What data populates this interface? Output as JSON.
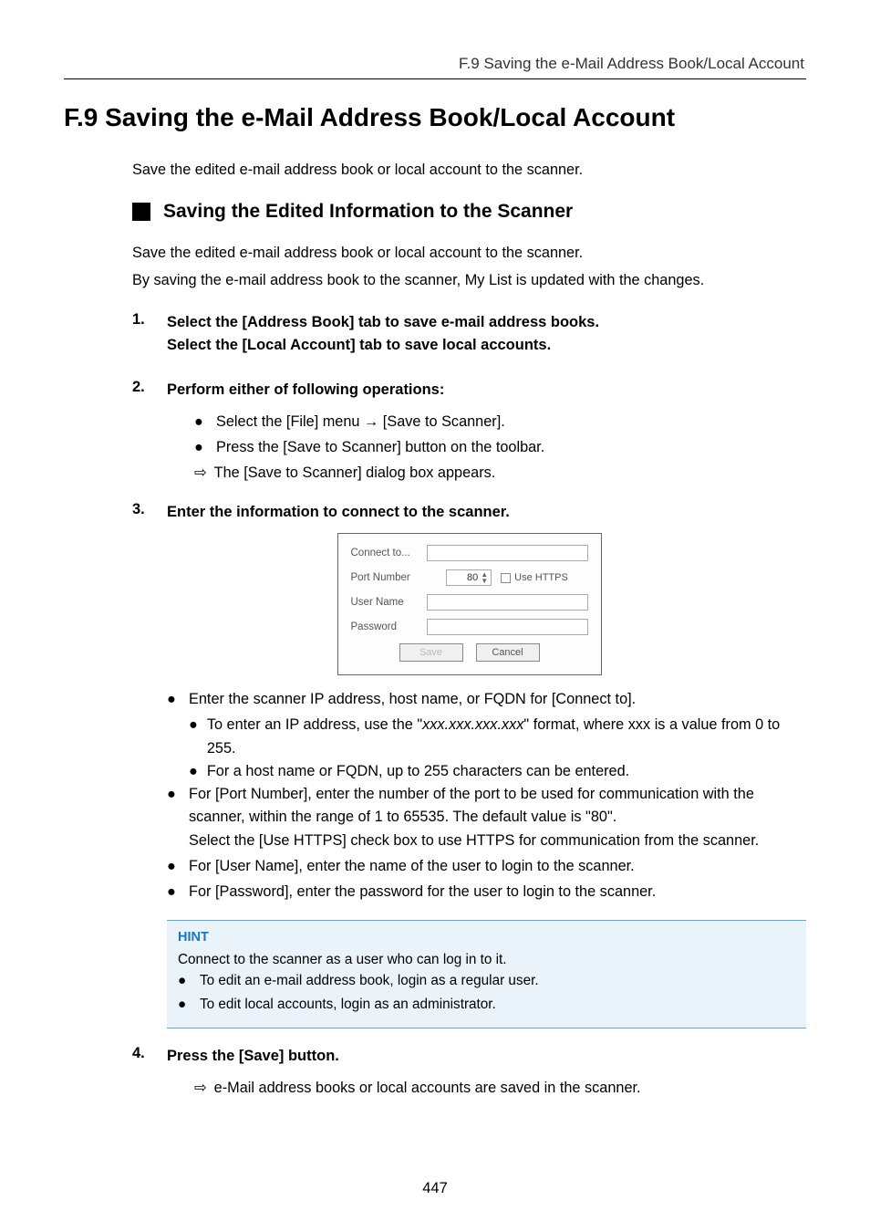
{
  "header": {
    "running": "F.9 Saving the e-Mail Address Book/Local Account"
  },
  "title": "F.9  Saving the e-Mail Address Book/Local Account",
  "intro": "Save the edited e-mail address book or local account to the scanner.",
  "subsection": {
    "title": "Saving the Edited Information to the Scanner",
    "para1": "Save the edited e-mail address book or local account to the scanner.",
    "para2": "By saving the e-mail address book to the scanner, My List is updated with the changes."
  },
  "steps": {
    "s1": {
      "num": "1.",
      "line1": "Select the [Address Book] tab to save e-mail address books.",
      "line2": "Select the [Local Account] tab to save local accounts."
    },
    "s2": {
      "num": "2.",
      "title": "Perform either of following operations:",
      "b1a": "Select the [File] menu ",
      "b1b": " [Save to Scanner].",
      "b2": "Press the [Save to Scanner] button on the toolbar.",
      "r1": "The [Save to Scanner] dialog box appears."
    },
    "s3": {
      "num": "3.",
      "title": "Enter the information to connect to the scanner.",
      "b1": "Enter the scanner IP address, host name, or FQDN for [Connect to].",
      "b1s1a": "To enter an IP address, use the \"",
      "b1s1i": "xxx.xxx.xxx.xxx",
      "b1s1b": "\" format, where xxx is a value from 0 to 255.",
      "b1s2": "For a host name or FQDN, up to 255 characters can be entered.",
      "b2a": "For [Port Number], enter the number of the port to be used for communication with the scanner, within the range of 1 to 65535. The default value is \"80\".",
      "b2b": "Select the [Use HTTPS] check box to use HTTPS for communication from the scanner.",
      "b3": "For [User Name], enter the name of the user to login to the scanner.",
      "b4": "For [Password], enter the password for the user to login to the scanner."
    },
    "s4": {
      "num": "4.",
      "title": "Press the [Save] button.",
      "r1": "e-Mail address books or local accounts are saved in the scanner."
    }
  },
  "dialog": {
    "connectLabel": "Connect to...",
    "portLabel": "Port Number",
    "portValue": "80",
    "httpsLabel": "Use HTTPS",
    "userLabel": "User Name",
    "passLabel": "Password",
    "saveBtn": "Save",
    "cancelBtn": "Cancel"
  },
  "hint": {
    "title": "HINT",
    "p1": "Connect to the scanner as a user who can log in to it.",
    "b1": "To edit an e-mail address book, login as a regular user.",
    "b2": "To edit local accounts, login as an administrator."
  },
  "pageNumber": "447"
}
